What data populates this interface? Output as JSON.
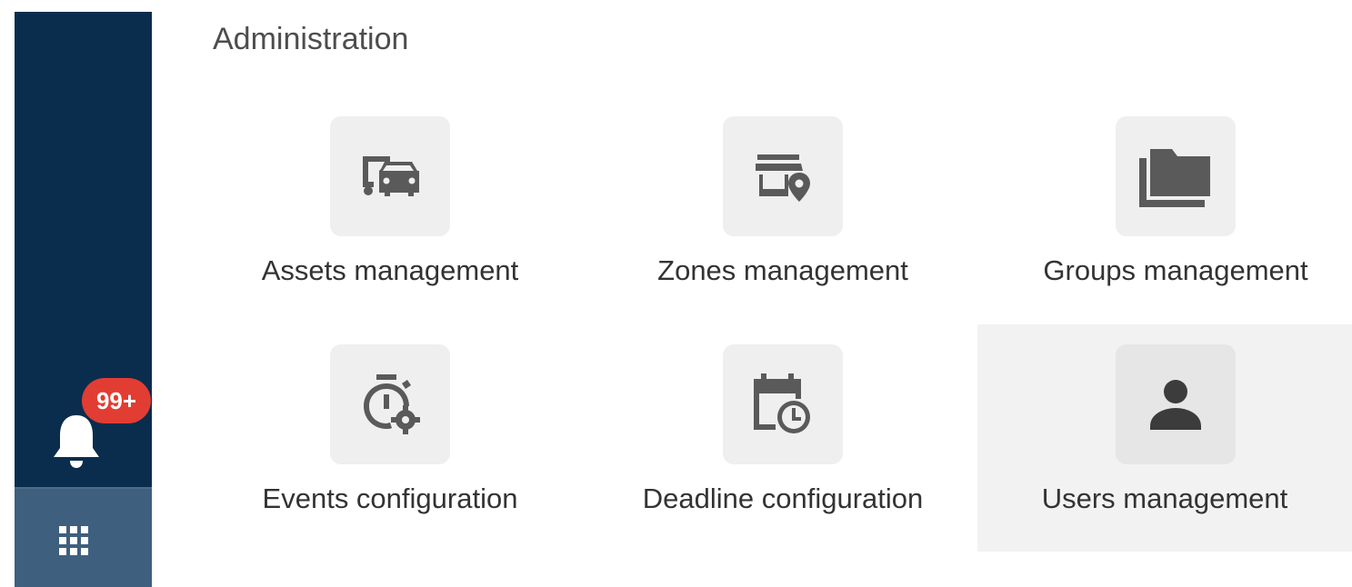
{
  "sidebar": {
    "notifications": {
      "badge": "99+",
      "icon": "bell-icon"
    },
    "apps_icon": "apps-grid-icon"
  },
  "section": {
    "title": "Administration"
  },
  "tiles": [
    {
      "label": "Assets management",
      "icon": "vehicles-icon"
    },
    {
      "label": "Zones management",
      "icon": "store-location-icon"
    },
    {
      "label": "Groups management",
      "icon": "folders-icon"
    },
    {
      "label": "Events configuration",
      "icon": "timer-settings-icon"
    },
    {
      "label": "Deadline configuration",
      "icon": "calendar-clock-icon"
    },
    {
      "label": "Users management",
      "icon": "person-icon",
      "selected": true
    }
  ],
  "colors": {
    "sidebar_bg": "#0a2d4e",
    "apps_bg": "#3f5f7e",
    "badge_bg": "#e23d32",
    "tile_icon_bg": "#efefef",
    "icon_fg": "#5a5a5a"
  }
}
